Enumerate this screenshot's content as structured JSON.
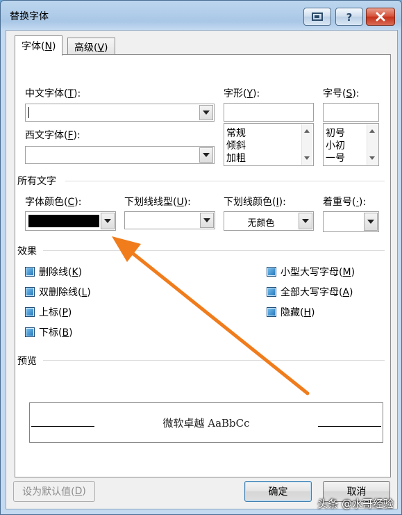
{
  "window": {
    "title": "替换字体"
  },
  "tabs": [
    {
      "label": "字体(N)",
      "text": "字体(",
      "key": "N",
      "end": ")"
    },
    {
      "label": "高级(V)",
      "text": "高级(",
      "key": "V",
      "end": ")"
    }
  ],
  "font": {
    "chinese": {
      "text": "中文字体(",
      "key": "T",
      "end": "):",
      "value": ""
    },
    "western": {
      "text": "西文字体(",
      "key": "F",
      "end": "):",
      "value": ""
    },
    "style": {
      "text": "字形(",
      "key": "Y",
      "end": "):",
      "value": "",
      "options": [
        "常规",
        "倾斜",
        "加粗"
      ]
    },
    "size": {
      "text": "字号(",
      "key": "S",
      "end": "):",
      "value": "",
      "options": [
        "初号",
        "小初",
        "一号"
      ]
    }
  },
  "all_text": {
    "heading": "所有文字",
    "font_color": {
      "text": "字体颜色(",
      "key": "C",
      "end": "):",
      "value_color": "#000000"
    },
    "underline_style": {
      "text": "下划线线型(",
      "key": "U",
      "end": "):",
      "value": ""
    },
    "underline_color": {
      "text": "下划线颜色(",
      "key": "I",
      "end": "):",
      "value": "无颜色"
    },
    "emphasis": {
      "text": "着重号(",
      "key": "·",
      "end": "):",
      "value": ""
    }
  },
  "effects": {
    "heading": "效果",
    "left": [
      {
        "text": "删除线(",
        "key": "K",
        "end": ")"
      },
      {
        "text": "双删除线(",
        "key": "L",
        "end": ")"
      },
      {
        "text": "上标(",
        "key": "P",
        "end": ")"
      },
      {
        "text": "下标(",
        "key": "B",
        "end": ")"
      }
    ],
    "right": [
      {
        "text": "小型大写字母(",
        "key": "M",
        "end": ")"
      },
      {
        "text": "全部大写字母(",
        "key": "A",
        "end": ")"
      },
      {
        "text": "隐藏(",
        "key": "H",
        "end": ")"
      }
    ]
  },
  "preview": {
    "heading": "预览",
    "sample": "微软卓越  AaBbCc"
  },
  "buttons": {
    "set_default": {
      "text": "设为默认值(",
      "key": "D",
      "end": ")"
    },
    "ok": "确定",
    "cancel": "取消"
  },
  "watermark": "头条 @水哥经验",
  "colors": {
    "annotation_arrow": "#f07c1c",
    "checkbox": "#1e73b8"
  },
  "icons": {
    "title_buttons": [
      "restore-icon",
      "help-icon",
      "close-icon"
    ]
  }
}
